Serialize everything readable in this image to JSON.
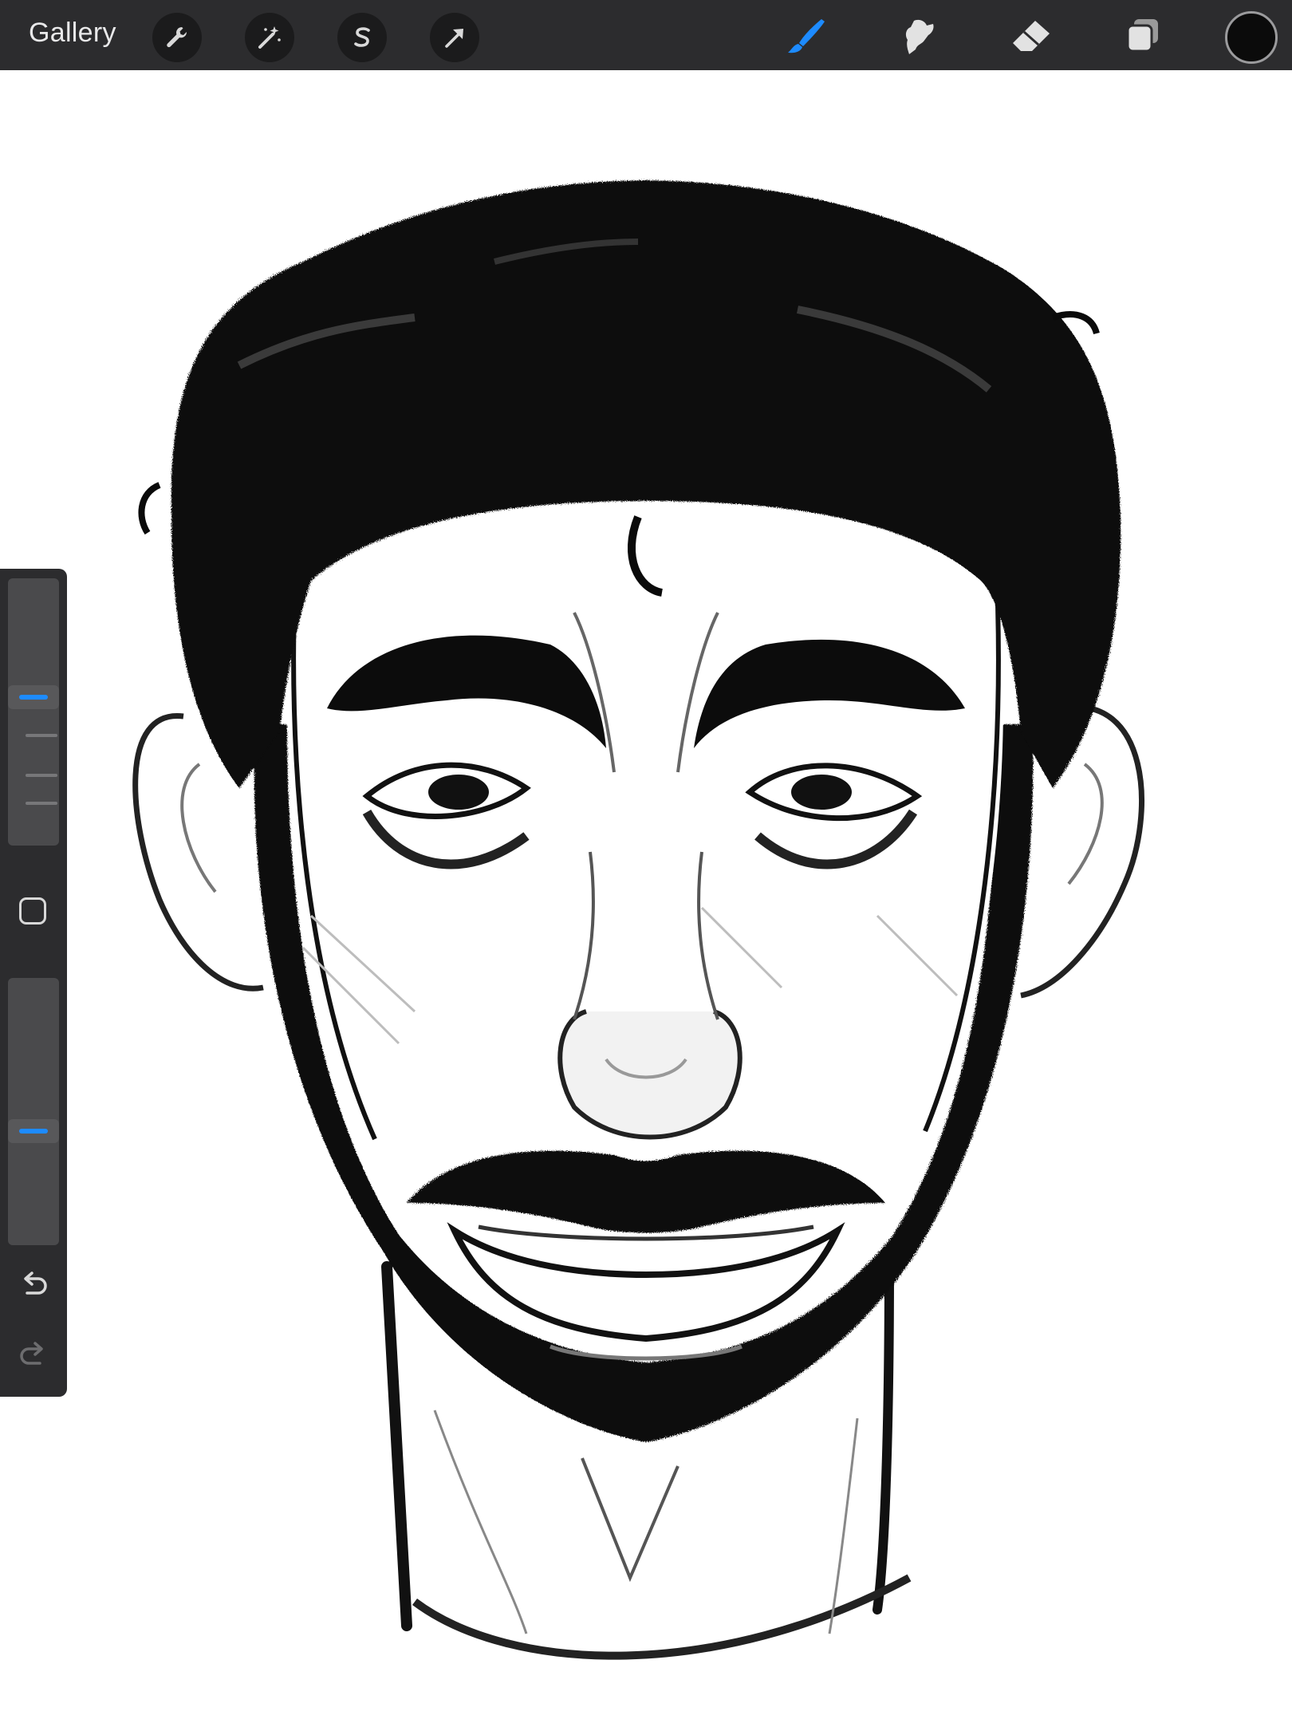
{
  "toolbar": {
    "gallery_label": "Gallery",
    "left_tools": [
      "wrench-icon",
      "magic-wand-icon",
      "selection-s-icon",
      "transform-arrow-icon"
    ],
    "right_tools": [
      "brush-icon",
      "smudge-icon",
      "eraser-icon",
      "layers-icon"
    ],
    "active_tool": "brush-icon",
    "active_color": "#0b0b0b",
    "accent_color": "#1d8bff"
  },
  "sidebar": {
    "brush_size_level": 0.56,
    "opacity_level": 0.42,
    "modify_button": "square-icon",
    "undo": "undo-icon",
    "redo": "redo-icon"
  },
  "canvas": {
    "content": "sketch-portrait"
  }
}
